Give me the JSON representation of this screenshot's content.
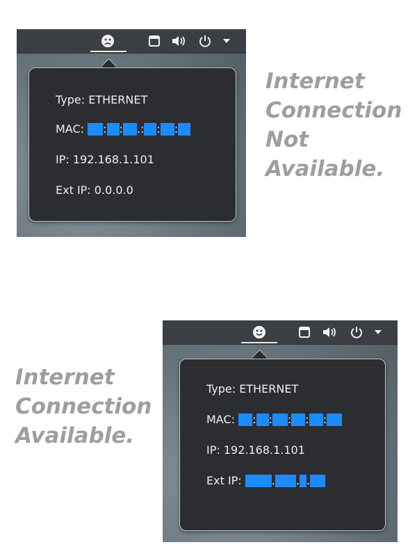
{
  "panels": [
    {
      "status": "not_available",
      "menu_icon": "sad-face-icon",
      "type_line": "Type: ETHERNET",
      "mac_label": "MAC:",
      "ip_line": "IP: 192.168.1.101",
      "ext_ip_label": "Ext IP:",
      "ext_ip_value": "0.0.0.0",
      "caption": [
        "Internet",
        "Connection",
        "Not",
        "Available."
      ]
    },
    {
      "status": "available",
      "menu_icon": "happy-face-icon",
      "type_line": "Type: ETHERNET",
      "mac_label": "MAC:",
      "ip_line": "IP: 192.168.1.101",
      "ext_ip_label": "Ext IP:",
      "ext_ip_value": "",
      "caption": [
        "Internet",
        "Connection",
        "Available."
      ]
    }
  ],
  "topbar_icons": [
    "window-icon",
    "volume-icon",
    "power-icon",
    "dropdown-arrow-icon"
  ],
  "colors": {
    "redaction": "#1a8cff",
    "caption": "#9e9e9e",
    "popup": "#2b2d31"
  }
}
